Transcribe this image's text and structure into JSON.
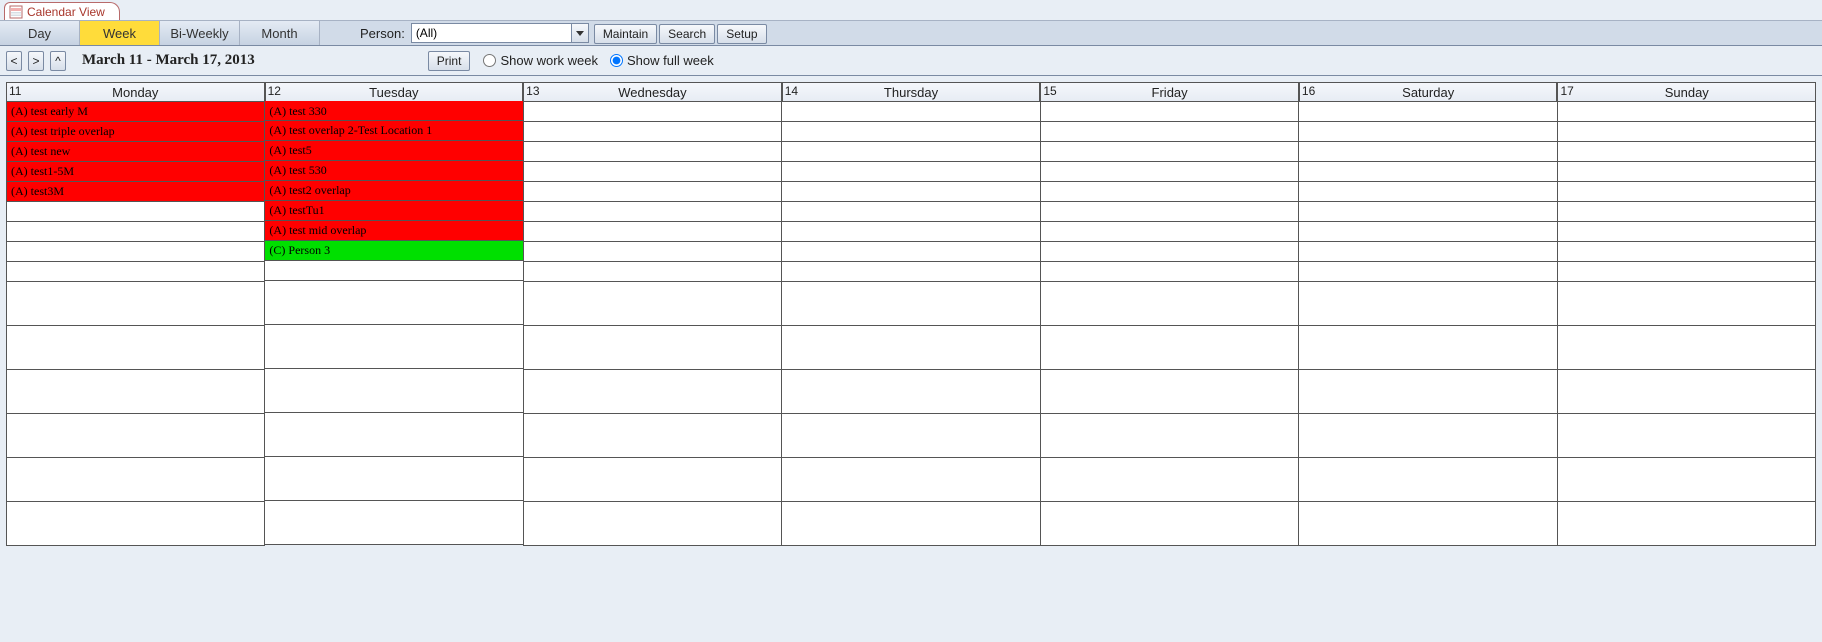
{
  "tab": {
    "label": "Calendar View"
  },
  "toolbar": {
    "views": [
      "Day",
      "Week",
      "Bi-Weekly",
      "Month"
    ],
    "active_view_index": 1,
    "person_label": "Person:",
    "person_value": "(All)",
    "maintain": "Maintain",
    "search": "Search",
    "setup": "Setup"
  },
  "subbar": {
    "prev": "<",
    "next": ">",
    "up": "^",
    "date_range": "March 11 - March 17, 2013",
    "print": "Print",
    "work_week": "Show work week",
    "full_week": "Show full week"
  },
  "days": [
    {
      "num": "11",
      "name": "Monday",
      "today": false,
      "events": [
        {
          "text": "(A) test early M",
          "color": "red"
        },
        {
          "text": "(A) test triple overlap",
          "color": "red"
        },
        {
          "text": "(A) test new",
          "color": "red"
        },
        {
          "text": "(A) test1-5M",
          "color": "red"
        },
        {
          "text": "(A) test3M",
          "color": "red"
        }
      ]
    },
    {
      "num": "12",
      "name": "Tuesday",
      "today": true,
      "events": [
        {
          "text": "(A) test 330",
          "color": "red"
        },
        {
          "text": "(A) test overlap 2-Test Location 1",
          "color": "red"
        },
        {
          "text": "(A) test5",
          "color": "red"
        },
        {
          "text": "(A) test 530",
          "color": "red"
        },
        {
          "text": "(A) test2 overlap",
          "color": "red"
        },
        {
          "text": "(A) testTu1",
          "color": "red"
        },
        {
          "text": "(A) test mid overlap",
          "color": "red"
        },
        {
          "text": "(C) Person 3",
          "color": "green"
        }
      ]
    },
    {
      "num": "13",
      "name": "Wednesday",
      "today": false,
      "events": []
    },
    {
      "num": "14",
      "name": "Thursday",
      "today": false,
      "events": []
    },
    {
      "num": "15",
      "name": "Friday",
      "today": false,
      "events": []
    },
    {
      "num": "16",
      "name": "Saturday",
      "today": false,
      "events": []
    },
    {
      "num": "17",
      "name": "Sunday",
      "today": false,
      "events": []
    }
  ],
  "grid": {
    "short_rows": 9,
    "tall_rows": 6
  }
}
